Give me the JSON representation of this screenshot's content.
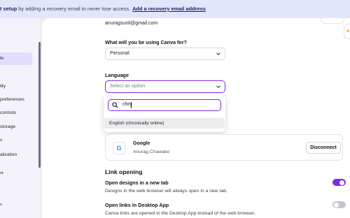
{
  "banner": {
    "bold_text": "t setup",
    "text": " by adding a recovery email to never lose access.",
    "link": "Add a recovery email address"
  },
  "sidebar": {
    "items": [
      {
        "label": "le"
      },
      {
        "label": "lity"
      },
      {
        "label": "preferences"
      },
      {
        "label": "controls"
      },
      {
        "label": "storage"
      },
      {
        "label": "s"
      },
      {
        "label": "alization"
      },
      {
        "label": "nt"
      },
      {
        "label": "s"
      }
    ]
  },
  "account": {
    "email": "anuragsunil@gmail.com",
    "usage_label": "What will you be using Canva for?",
    "usage_value": "Personal",
    "language_label": "Language",
    "language_placeholder": "Select an option",
    "language_search_value": "chro",
    "language_option": "English (chronically online)"
  },
  "connected": {
    "provider": "Google",
    "account_name": "Anurag Chawake",
    "disconnect_label": "Disconnect"
  },
  "link_opening": {
    "heading": "Link opening",
    "new_tab_title": "Open designs in a new tab",
    "new_tab_desc": "Designs in the web browser will always open in a new tab.",
    "new_tab_on": true,
    "desktop_title": "Open links in Desktop App",
    "desktop_desc": "Canva links are opened in the Desktop App instead of the web browser.",
    "desktop_on": false
  },
  "colors": {
    "accent": "#7d2ae8",
    "toggle_off": "#c3c6cf",
    "banner_bg": "#e3e6fb"
  }
}
